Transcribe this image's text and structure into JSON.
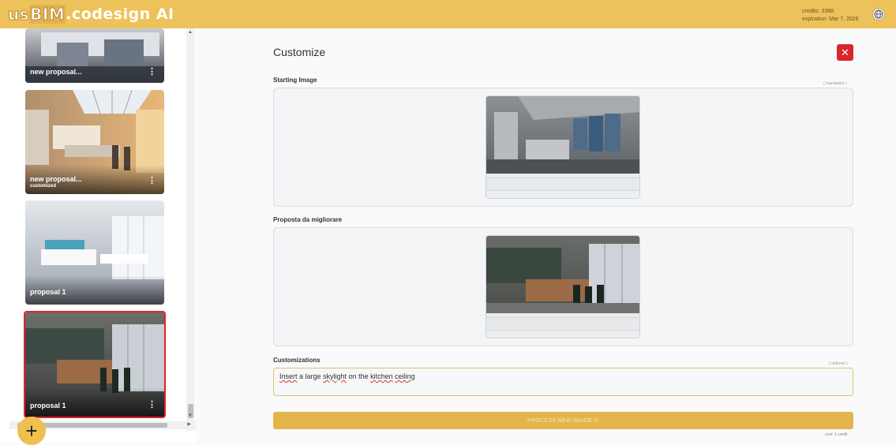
{
  "header": {
    "logo_us": "us",
    "logo_bim": "BIM",
    "logo_rest": ".codesign AI",
    "credits": "credits: 3388",
    "expiration": "expiration: Mar 7, 2026",
    "globe_icon": "globe-icon"
  },
  "sidebar": {
    "items": [
      {
        "label": "new proposal...",
        "sub": "",
        "selected": false
      },
      {
        "label": "new proposal...",
        "sub": "customized",
        "selected": false
      },
      {
        "label": "proposal 1",
        "sub": "",
        "selected": false
      },
      {
        "label": "proposal 1",
        "sub": "",
        "selected": true
      }
    ],
    "menu_glyph": "⋮",
    "add_glyph": "+"
  },
  "main": {
    "title": "Customize",
    "close_glyph": "✕",
    "starting_image": {
      "label": "Starting Image",
      "hint": "( mandatory )"
    },
    "proposal": {
      "label": "Proposta da migliorare"
    },
    "customizations": {
      "label": "Customizations",
      "hint": "( optional )",
      "value_parts": [
        "Insert",
        " a large ",
        "skylight",
        " on the ",
        "kitchen",
        " ",
        "ceiling"
      ]
    },
    "process_label": "PROCESS NEW IMAGE !!!",
    "cost": "cost: 1 credit"
  },
  "colors": {
    "header_bg": "#eec25a",
    "accent": "#e3b54a",
    "danger": "#d9262a"
  }
}
